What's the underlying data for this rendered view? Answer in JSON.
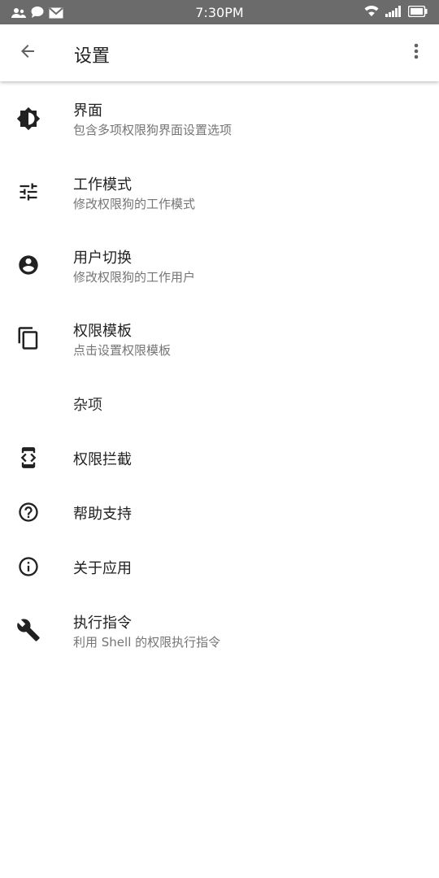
{
  "status_bar": {
    "time": "7:30PM",
    "left_icons": [
      "contacts-icon",
      "chat-bubble-icon",
      "mail-icon"
    ],
    "right_icons": [
      "wifi-icon",
      "signal-icon",
      "battery-icon"
    ]
  },
  "app_bar": {
    "title": "设置",
    "back_icon": "arrow-back-icon",
    "more_icon": "more-vert-icon"
  },
  "preferences": [
    {
      "icon": "brightness-icon",
      "title": "界面",
      "summary": "包含多项权限狗界面设置选项"
    },
    {
      "icon": "tune-icon",
      "title": "工作模式",
      "summary": "修改权限狗的工作模式"
    },
    {
      "icon": "account-circle-icon",
      "title": "用户切换",
      "summary": "修改权限狗的工作用户"
    },
    {
      "icon": "copy-icon",
      "title": "权限模板",
      "summary": "点击设置权限模板"
    }
  ],
  "category": {
    "title": "杂项"
  },
  "misc_items": [
    {
      "icon": "developer-mode-icon",
      "title": "权限拦截"
    },
    {
      "icon": "help-icon",
      "title": "帮助支持"
    },
    {
      "icon": "info-icon",
      "title": "关于应用"
    },
    {
      "icon": "wrench-icon",
      "title": "执行指令",
      "summary": "利用 Shell 的权限执行指令"
    }
  ],
  "colors": {
    "status_bar": "#6b6b6b",
    "title_text": "#212121",
    "summary_text": "#757575"
  }
}
